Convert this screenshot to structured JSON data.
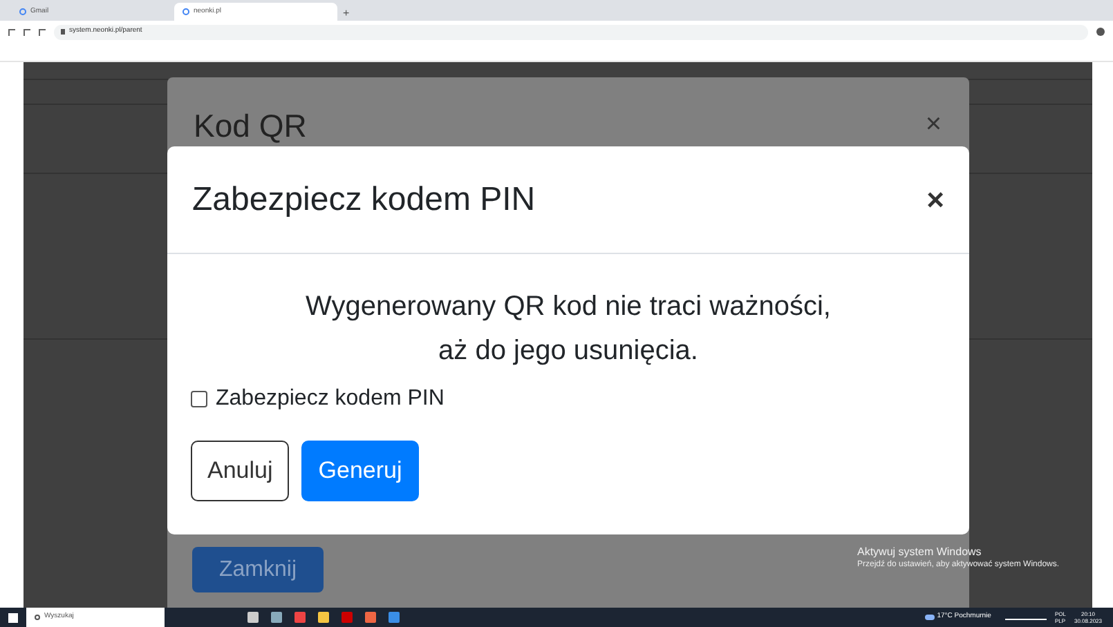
{
  "browser": {
    "tabs": [
      {
        "title": "Gmail",
        "selected": false
      },
      {
        "title": "neonki.pl",
        "selected": true
      }
    ],
    "new_tab": "+",
    "url": "system.neonki.pl/parent"
  },
  "back_modal": {
    "title": "Kod QR",
    "close": "×",
    "button": "Zamknij"
  },
  "modal": {
    "title": "Zabezpiecz kodem PIN",
    "close": "×",
    "message_lines": [
      "Wygenerowany QR kod nie traci ważności,",
      "aż do jego usunięcia."
    ],
    "checkbox": {
      "label": "Zabezpiecz kodem PIN",
      "checked": false
    },
    "buttons": [
      {
        "label": "Anuluj",
        "kind": "secondary"
      },
      {
        "label": "Generuj",
        "kind": "primary"
      }
    ]
  },
  "activation": {
    "title": "Aktywuj system Windows",
    "subtitle": "Przejdź do ustawień, aby aktywować system Windows."
  },
  "taskbar": {
    "search_placeholder": "Wyszukaj",
    "weather": "17°C Pochmurnie",
    "language": [
      "POL",
      "PLP"
    ],
    "time": "20:10",
    "date": "30.08.2023"
  }
}
